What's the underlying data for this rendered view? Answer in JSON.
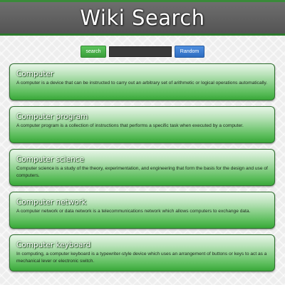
{
  "header": {
    "title": "Wiki Search"
  },
  "search": {
    "button_label": "search",
    "input_value": "",
    "random_label": "Random"
  },
  "results": [
    {
      "title": "Computer",
      "snippet": "A computer is a device that can be instructed to carry out an arbitrary set of arithmetic or logical operations automatically."
    },
    {
      "title": "Computer program",
      "snippet": "A computer program is a collection of instructions that performs a specific task when executed by a computer."
    },
    {
      "title": "Computer science",
      "snippet": "Computer science is a study of the theory, experimentation, and engineering that form the basis for the design and use of computers."
    },
    {
      "title": "Computer network",
      "snippet": "A computer network or data network is a telecommunications network which allows computers to exchange data."
    },
    {
      "title": "Computer keyboard",
      "snippet": "In computing, a computer keyboard is a typewriter-style device which uses an arrangement of buttons or keys to act as a mechanical lever or electronic switch."
    }
  ]
}
